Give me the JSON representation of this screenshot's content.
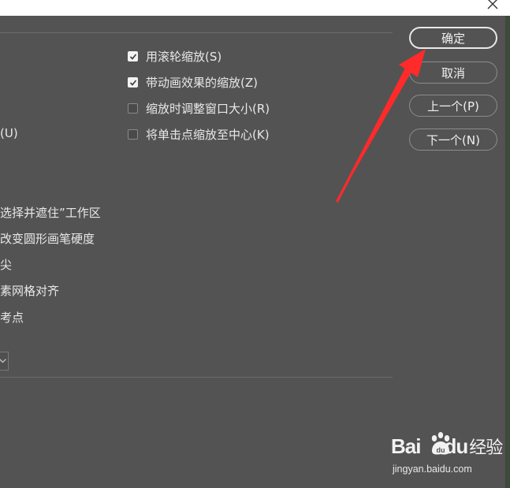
{
  "colors": {
    "background": "#535353",
    "titlebar": "#ffffff",
    "text": "#e8e8e8",
    "annotation_arrow": "#ff2a2a"
  },
  "options": [
    {
      "label": "用滚轮缩放(S)",
      "checked": true
    },
    {
      "label": "带动画效果的缩放(Z)",
      "checked": true
    },
    {
      "label": "缩放时调整窗口大小(R)",
      "checked": false
    },
    {
      "label": "将单击点缩放至中心(K)",
      "checked": false
    }
  ],
  "left_labels": [
    "(U)",
    "选择并遮住”工作区",
    "改变圆形画笔硬度",
    "尖",
    "素网格对齐",
    "考点"
  ],
  "buttons": {
    "ok": "确定",
    "cancel": "取消",
    "prev": "上一个(P)",
    "next": "下一个(N)"
  },
  "icons": {
    "close": "close-icon",
    "checkmark": "checkmark-icon",
    "dropdown": "chevron-down-icon"
  },
  "watermark": {
    "logo_pre": "Bai",
    "logo_mid": "du",
    "logo_post": "经验",
    "url": "jingyan.baidu.com"
  }
}
